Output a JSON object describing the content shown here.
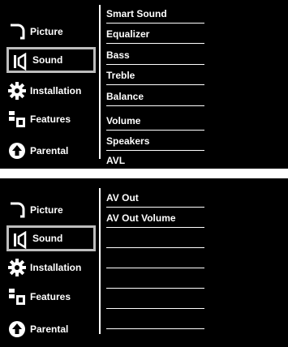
{
  "screens": [
    {
      "menu": [
        {
          "label": "Picture",
          "icon": "picture-icon",
          "selected": false
        },
        {
          "label": "Sound",
          "icon": "speaker-icon",
          "selected": true
        },
        {
          "label": "Installation",
          "icon": "gear-icon",
          "selected": false
        },
        {
          "label": "Features",
          "icon": "features-icon",
          "selected": false
        },
        {
          "label": "Parental",
          "icon": "parental-icon",
          "selected": false
        }
      ],
      "submenu": [
        "Smart Sound",
        "Equalizer",
        "Bass",
        "Treble",
        "Balance",
        "Volume",
        "Speakers",
        "AVL"
      ]
    },
    {
      "menu": [
        {
          "label": "Picture",
          "icon": "picture-icon",
          "selected": false
        },
        {
          "label": "Sound",
          "icon": "speaker-icon",
          "selected": true
        },
        {
          "label": "Installation",
          "icon": "gear-icon",
          "selected": false
        },
        {
          "label": "Features",
          "icon": "features-icon",
          "selected": false
        },
        {
          "label": "Parental",
          "icon": "parental-icon",
          "selected": false
        }
      ],
      "submenu": [
        "AV Out",
        "AV Out Volume",
        "",
        "",
        "",
        "",
        ""
      ]
    }
  ],
  "colors": {
    "background": "#000000",
    "text": "#ffffff",
    "selection_border": "#bdbdbd",
    "page": "#ffffff"
  }
}
